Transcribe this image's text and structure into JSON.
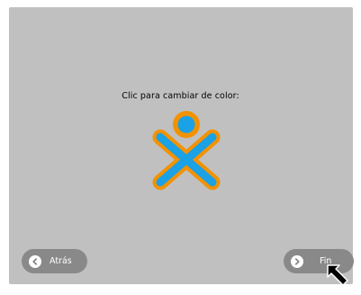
{
  "activity": {
    "prompt": "Clic para cambiar de color:"
  },
  "xo_icon": {
    "name": "xo-icon",
    "stroke_color": "#f39200",
    "fill_color": "#1aa1e6"
  },
  "navigation": {
    "back_label": "Atrás",
    "next_label": "Fin",
    "back_icon": "chevron-left-icon",
    "next_icon": "chevron-right-icon"
  },
  "colors": {
    "panel_background": "#c0c0c0",
    "button_background": "#898989",
    "button_text": "#ffffff"
  }
}
